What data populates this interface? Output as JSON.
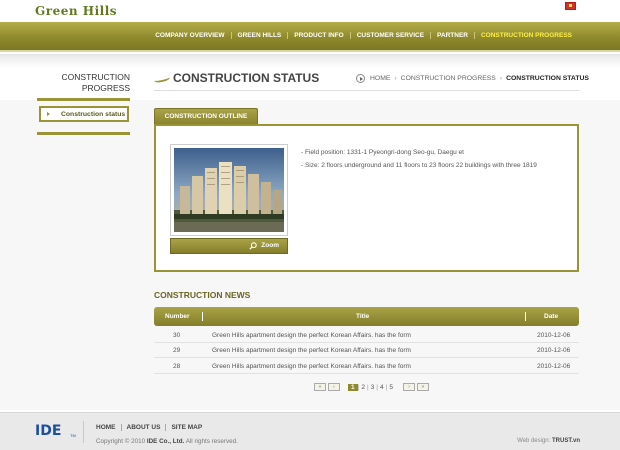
{
  "header": {
    "logo": "Green Hills",
    "nav": [
      "COMPANY OVERVIEW",
      "GREEN HILLS",
      "PRODUCT INFO",
      "CUSTOMER SERVICE",
      "PARTNER",
      "CONSTRUCTION PROGRESS"
    ],
    "active_nav_index": 5,
    "flag_icon": "vietnam-flag-icon"
  },
  "sidebar": {
    "title_line1": "CONSTRUCTION",
    "title_line2": "PROGRESS",
    "item": "Construction status"
  },
  "main": {
    "title": "CONSTRUCTION STATUS",
    "breadcrumb": [
      "HOME",
      "CONSTRUCTION PROGRESS",
      "CONSTRUCTION STATUS"
    ],
    "tab_label": "CONSTRUCTION OUTLINE",
    "zoom_label": "Zoom",
    "info_lines": [
      "- Field position: 1331-1 Pyeongri-dong Seo-gu, Daegu et",
      "- Size: 2 floors underground and 11 floors to 23 floors 22 buildings with three 1819"
    ]
  },
  "news": {
    "title": "CONSTRUCTION NEWS",
    "columns": [
      "Number",
      "Title",
      "Date"
    ],
    "rows": [
      {
        "number": "30",
        "title": "Green Hills apartment design the perfect Korean Affairs. has the form",
        "date": "2010-12-06"
      },
      {
        "number": "29",
        "title": "Green Hills apartment design the perfect Korean Affairs. has the form",
        "date": "2010-12-06"
      },
      {
        "number": "28",
        "title": "Green Hills apartment design the perfect Korean Affairs. has the form",
        "date": "2010-12-06"
      }
    ],
    "pager": {
      "first": "«",
      "prev": "‹",
      "pages": [
        "1",
        "2",
        "3",
        "4",
        "5"
      ],
      "current": "1",
      "next": "›",
      "last": "»"
    }
  },
  "footer": {
    "logo": "IDE",
    "logo_sub": "TM",
    "links": [
      "HOME",
      "ABOUT US",
      "SITE MAP"
    ],
    "copyright_prefix": "Copyright © 2010",
    "company": "IDE Co., Ltd.",
    "rights": "All rights reserved.",
    "design_label": "Web design:",
    "design_by": "TRUST.vn"
  },
  "colors": {
    "accent": "#9a9437",
    "nav_active": "#ffee44",
    "footer_logo": "#1b4fa3"
  }
}
